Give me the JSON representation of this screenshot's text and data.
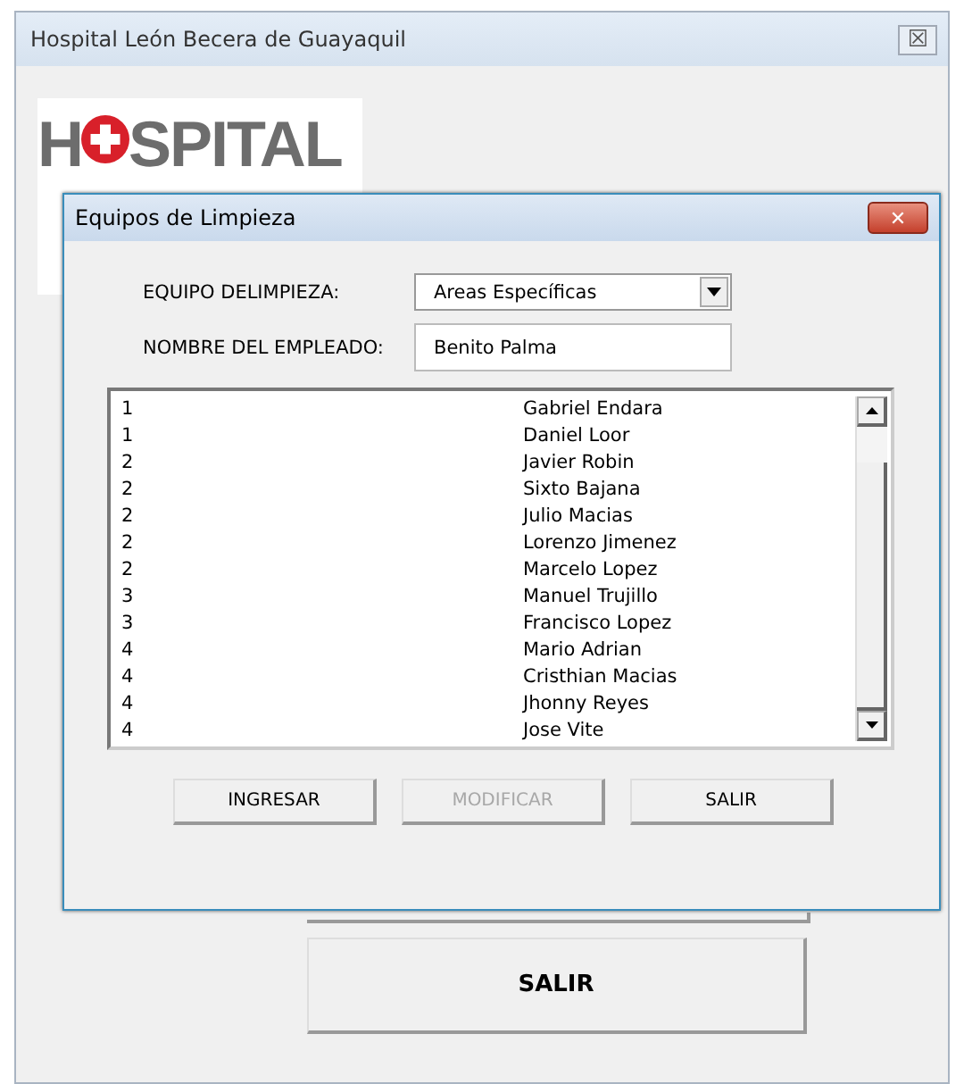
{
  "window": {
    "title": "Hospital León Becera de Guayaquil",
    "close": "☒"
  },
  "logo": {
    "first": "H",
    "rest": "SPITAL"
  },
  "dialog": {
    "title": "Equipos de Limpieza",
    "close": "✕",
    "team_label": "EQUIPO DELIMPIEZA:",
    "team_value": "Areas Específicas",
    "employee_label": "NOMBRE DEL EMPLEADO:",
    "employee_value": "Benito Palma",
    "rows": [
      {
        "group": "1",
        "name": "Gabriel Endara"
      },
      {
        "group": "1",
        "name": "Daniel Loor"
      },
      {
        "group": "2",
        "name": "Javier Robin"
      },
      {
        "group": "2",
        "name": "Sixto Bajana"
      },
      {
        "group": "2",
        "name": "Julio Macias"
      },
      {
        "group": "2",
        "name": "Lorenzo Jimenez"
      },
      {
        "group": "2",
        "name": "Marcelo Lopez"
      },
      {
        "group": "3",
        "name": "Manuel Trujillo"
      },
      {
        "group": "3",
        "name": "Francisco Lopez"
      },
      {
        "group": "4",
        "name": "Mario Adrian"
      },
      {
        "group": "4",
        "name": "Cristhian Macias"
      },
      {
        "group": "4",
        "name": "Jhonny Reyes"
      },
      {
        "group": "4",
        "name": "Jose Vite"
      }
    ],
    "buttons": [
      {
        "label": "INGRESAR",
        "disabled": false
      },
      {
        "label": "MODIFICAR",
        "disabled": true
      },
      {
        "label": "SALIR",
        "disabled": false
      }
    ]
  },
  "main_button": "SALIR"
}
